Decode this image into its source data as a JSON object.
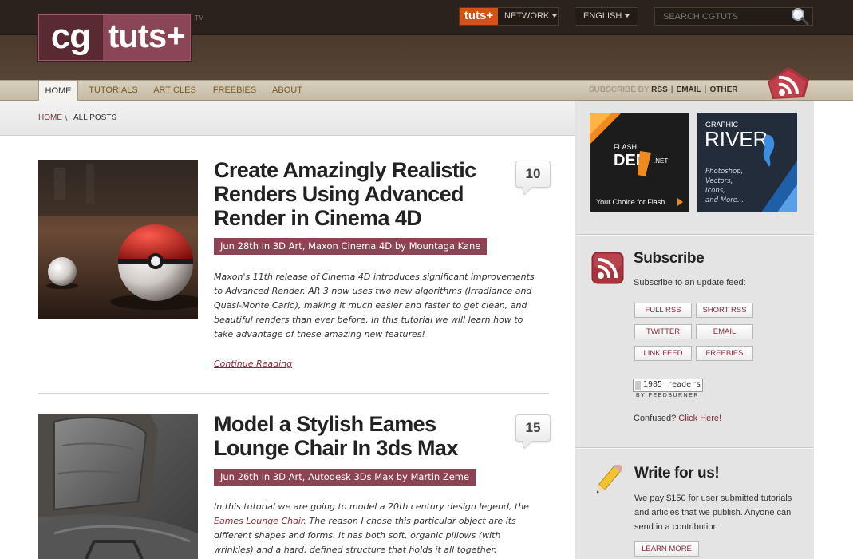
{
  "logo": {
    "left": "cg",
    "right": "tuts+",
    "tm": "TM"
  },
  "header": {
    "network_badge": "tuts+",
    "network_label": "NETWORK",
    "language": "ENGLISH",
    "search_placeholder": "SEARCH CGTUTS"
  },
  "nav": {
    "items": [
      {
        "label": "HOME",
        "active": true
      },
      {
        "label": "TUTORIALS"
      },
      {
        "label": "ARTICLES"
      },
      {
        "label": "FREEBIES"
      },
      {
        "label": "ABOUT"
      }
    ],
    "subscribe_by": "SUBSCRIBE BY",
    "rss": "RSS",
    "email": "EMAIL",
    "other": "OTHER"
  },
  "breadcrumb": {
    "home": "HOME",
    "sep": "\\",
    "current": "ALL POSTS"
  },
  "posts": [
    {
      "title": "Create Amazingly Realistic Renders Using Advanced Render in Cinema 4D",
      "meta": "Jun 28th in 3D Art, Maxon Cinema 4D by Mountaga Kane",
      "comments": "10",
      "excerpt": "Maxon's 11th release of Cinema 4D introduces significant improvements to Advanced Render. AR 3 now uses two new algorithms (Irradiance and Quasi-Monte Carlo), making it much easier and faster to get clean, and beautiful renders than ever before. In this tutorial we will learn how to take advantage of these amazing new features!",
      "continue": "Continue Reading"
    },
    {
      "title": "Model a Stylish Eames Lounge Chair In 3ds Max",
      "meta": "Jun 26th in 3D Art, Autodesk 3Ds Max by Martin Zeme",
      "comments": "15",
      "excerpt_before": "In this tutorial we are going to model a 20th century design legend, the ",
      "excerpt_link": "Eames Lounge Chair",
      "excerpt_after": ". The reason I chose this particular object are its different shapes and forms. It has both soft, organic pillows (with wrinkles) and a hard, defined structure that holds it all together,"
    }
  ],
  "sidebar": {
    "ad1": {
      "top": "FLASH",
      "brand": "DEN",
      "suffix": ".NET",
      "tagline": "Your Choice for Flash"
    },
    "ad2": {
      "top": "GRAPHIC",
      "brand": "RIVER",
      "lines": [
        "Photoshop,",
        "Vectors,",
        "Icons,",
        "and More..."
      ]
    },
    "subscribe": {
      "title": "Subscribe",
      "desc": "Subscribe to an update feed:",
      "buttons": [
        "FULL RSS",
        "SHORT RSS",
        "TWITTER",
        "EMAIL",
        "LINK FEED",
        "FREEBIES"
      ],
      "readers": "1985 readers",
      "by": "BY FEEDBURNER",
      "confused": "Confused?",
      "click_here": "Click Here!"
    },
    "write": {
      "title": "Write for us!",
      "desc": "We pay $150 for user submitted tutorials and articles that we publish. Anyone can send in a contribution",
      "button": "LEARN MORE"
    }
  },
  "colors": {
    "accent": "#8d4452",
    "header_dark": "#2b221c",
    "network_orange": "#d35215"
  }
}
